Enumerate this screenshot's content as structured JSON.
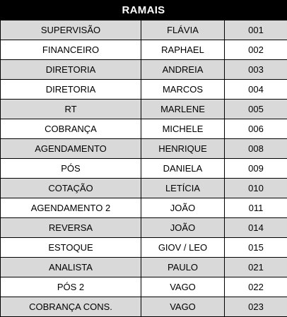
{
  "header": {
    "title": "RAMAIS"
  },
  "rows": [
    {
      "sector": "SUPERVISÃO",
      "name": "FLÁVIA",
      "ext": "001"
    },
    {
      "sector": "FINANCEIRO",
      "name": "RAPHAEL",
      "ext": "002"
    },
    {
      "sector": "DIRETORIA",
      "name": "ANDREIA",
      "ext": "003"
    },
    {
      "sector": "DIRETORIA",
      "name": "MARCOS",
      "ext": "004"
    },
    {
      "sector": "RT",
      "name": "MARLENE",
      "ext": "005"
    },
    {
      "sector": "COBRANÇA",
      "name": "MICHELE",
      "ext": "006"
    },
    {
      "sector": "AGENDAMENTO",
      "name": "HENRIQUE",
      "ext": "008"
    },
    {
      "sector": "PÓS",
      "name": "DANIELA",
      "ext": "009"
    },
    {
      "sector": "COTAÇÃO",
      "name": "LETÍCIA",
      "ext": "010"
    },
    {
      "sector": "AGENDAMENTO 2",
      "name": "JOÃO",
      "ext": "011"
    },
    {
      "sector": "REVERSA",
      "name": "JOÃO",
      "ext": "014"
    },
    {
      "sector": "ESTOQUE",
      "name": "GIOV / LEO",
      "ext": "015"
    },
    {
      "sector": "ANALISTA",
      "name": "PAULO",
      "ext": "021"
    },
    {
      "sector": "PÓS 2",
      "name": "VAGO",
      "ext": "022"
    },
    {
      "sector": "COBRANÇA CONS.",
      "name": "VAGO",
      "ext": "023"
    }
  ]
}
